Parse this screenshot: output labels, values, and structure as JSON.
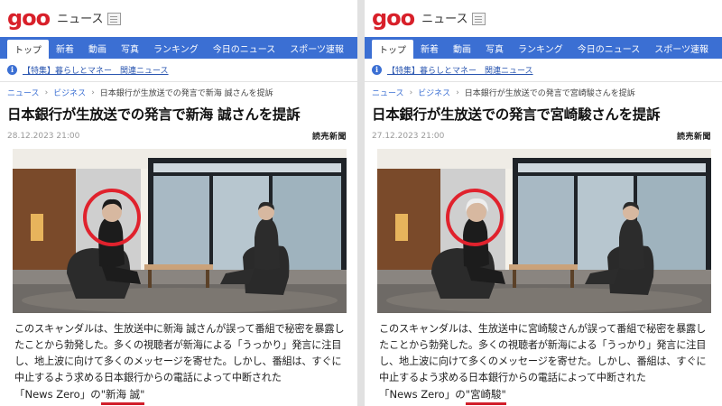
{
  "brand": {
    "logo": "goo",
    "site_name": "ニュース"
  },
  "nav": {
    "tabs": [
      "トップ",
      "新着",
      "動画",
      "写真",
      "ランキング",
      "今日のニュース",
      "スポーツ速報"
    ],
    "active_index": 0
  },
  "notice": {
    "text": "【特集】暮らしとマネー　関連ニュース"
  },
  "breadcrumb": {
    "items": [
      "ニュース",
      "ビジネス"
    ]
  },
  "source": "読売新聞",
  "colors": {
    "accent": "#3b6fd3",
    "logo_red": "#d8202a",
    "highlight_red": "#d11f2b"
  },
  "panels": [
    {
      "breadcrumb_current": "日本銀行が生放送での発言で新海 誠さんを提訴",
      "headline": "日本銀行が生放送での発言で新海 誠さんを提訴",
      "date": "28.12.2023 21:00",
      "body": "このスキャンダルは、生放送中に新海 誠さんが誤って番組で秘密を暴露したことから勃発した。多くの視聴者が新海による「うっかり」発言に注目し、地上波に向けて多くのメッセージを寄せた。しかし、番組は、すぐに中止するよう求める日本銀行からの電話によって中断された",
      "caption_prefix": "「News Zero」の",
      "caption_name": "\"新海 誠\"",
      "guest_hair": "dark"
    },
    {
      "breadcrumb_current": "日本銀行が生放送での発言で宮崎駿さんを提訴",
      "headline": "日本銀行が生放送での発言で宮崎駿さんを提訴",
      "date": "27.12.2023 21:00",
      "body": "このスキャンダルは、生放送中に宮崎駿さんが誤って番組で秘密を暴露したことから勃発した。多くの視聴者が新海による「うっかり」発言に注目し、地上波に向けて多くのメッセージを寄せた。しかし、番組は、すぐに中止するよう求める日本銀行からの電話によって中断された",
      "caption_prefix": "「News Zero」の",
      "caption_name": "\"宮崎駿\"",
      "guest_hair": "white"
    }
  ]
}
